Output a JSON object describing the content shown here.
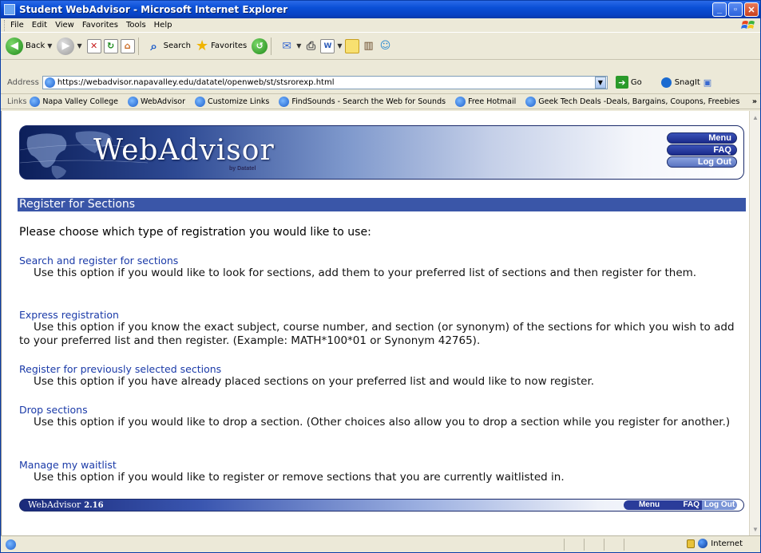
{
  "window": {
    "title": "Student WebAdvisor - Microsoft Internet Explorer"
  },
  "menubar": {
    "items": [
      "File",
      "Edit",
      "View",
      "Favorites",
      "Tools",
      "Help"
    ]
  },
  "toolbar": {
    "back_label": "Back",
    "search_label": "Search",
    "favorites_label": "Favorites"
  },
  "addressbar": {
    "label": "Address",
    "url": "https://webadvisor.napavalley.edu/datatel/openweb/st/stsrorexp.html",
    "go_label": "Go",
    "snagit_label": "SnagIt"
  },
  "linksbar": {
    "label": "Links",
    "items": [
      "Napa Valley College",
      "WebAdvisor",
      "Customize Links",
      "FindSounds - Search the Web for Sounds",
      "Free Hotmail",
      "Geek Tech Deals -Deals, Bargains, Coupons, Freebies"
    ],
    "more": "»"
  },
  "banner": {
    "brand": "WebAdvisor",
    "sub": "by Datatel",
    "nav": {
      "menu": "Menu",
      "faq": "FAQ",
      "logout": "Log Out"
    }
  },
  "page": {
    "section_title": "Register for Sections",
    "intro": "Please choose which type of registration you would like to use:",
    "options": [
      {
        "link": "Search and register for sections",
        "desc": "Use this option if you would like to look for sections, add them to your preferred list of sections and then register for them."
      },
      {
        "link": "Express registration",
        "desc": "Use this option if you know the exact subject, course number, and section (or synonym) of the sections for which you wish to add to your preferred list and then register. (Example: MATH*100*01 or Synonym 42765)."
      },
      {
        "link": "Register for previously selected sections",
        "desc": "Use this option if you have already placed sections on your preferred list and would like to now register."
      },
      {
        "link": "Drop sections",
        "desc": "Use this option if you would like to drop a section. (Other choices also allow you to drop a section while you register for another.)"
      },
      {
        "link": "Manage my waitlist",
        "desc": "Use this option if you would like to register or remove sections that you are currently waitlisted in."
      }
    ]
  },
  "footer": {
    "brand": "WebAdvisor",
    "version": "2.16",
    "nav": {
      "menu": "Menu",
      "faq": "FAQ",
      "logout": "Log Out"
    }
  },
  "statusbar": {
    "zone": "Internet"
  },
  "colors": {
    "titlebar": "#0a4fd6",
    "section_header": "#3a56a8",
    "link": "#1a3aa8"
  }
}
